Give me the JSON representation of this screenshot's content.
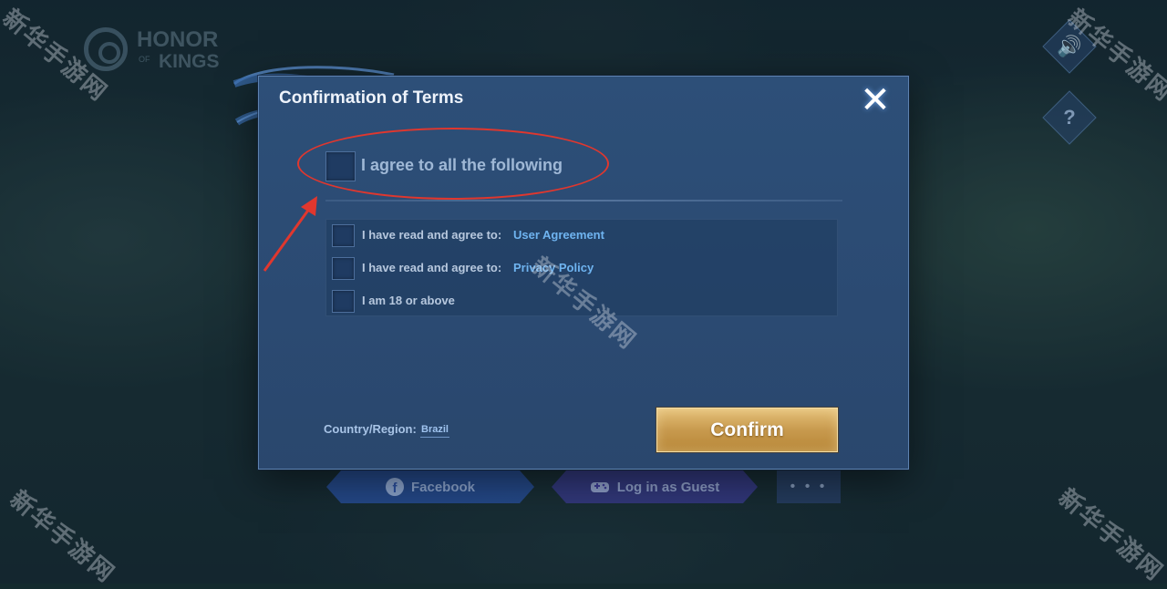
{
  "background": {
    "logo": {
      "line1": "HONOR",
      "line2": "KINGS",
      "small": "OF"
    },
    "side_buttons": [
      {
        "icon": "speaker-icon",
        "glyph": "🔊"
      },
      {
        "icon": "help-icon",
        "glyph": "?"
      }
    ],
    "login": {
      "facebook_label": "Facebook",
      "guest_label": "Log in as Guest",
      "more_label": "• • •"
    }
  },
  "dialog": {
    "title": "Confirmation of Terms",
    "close_glyph": "✕",
    "master_label": "I agree to all the following",
    "terms": [
      {
        "text": "I have read and agree to:",
        "link": "User Agreement"
      },
      {
        "text": "I have read and agree to:",
        "link": "Privacy Policy"
      },
      {
        "text": "I am 18 or above",
        "link": ""
      }
    ],
    "country_label": "Country/Region:",
    "country_value": "Brazil",
    "confirm_label": "Confirm"
  },
  "annotations": {
    "highlight_color": "#e0372e"
  },
  "watermarks": [
    "新华手游网",
    "新华手游网",
    "新华手游网",
    "新华手游网",
    "新华手游网"
  ],
  "colors": {
    "dialog_bg": "#2d4f78",
    "link": "#6fb4f0",
    "confirm_gold": "#c89a4e"
  }
}
